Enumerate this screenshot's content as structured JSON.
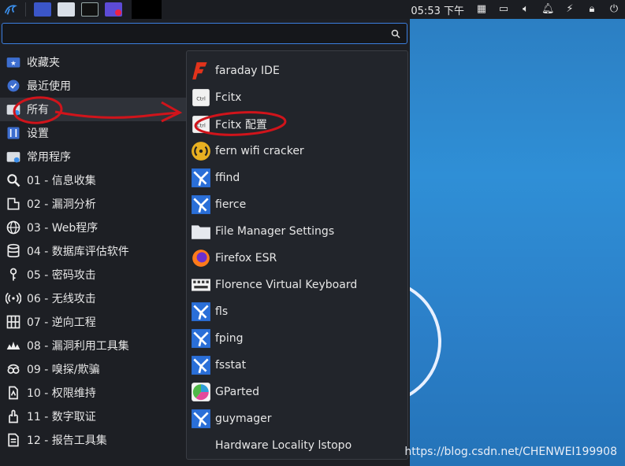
{
  "panel": {
    "clock": "05:53 下午",
    "launcher_icon": "kali-dragon-icon",
    "task_icons": [
      "files-icon",
      "file-manager-icon",
      "terminal-icon",
      "screen-recorder-icon"
    ],
    "tray_icons": [
      "keyboard-icon",
      "display-icon",
      "volume-icon",
      "notification-icon",
      "update-icon",
      "lock-icon",
      "logout-icon"
    ]
  },
  "search": {
    "placeholder": "",
    "value": ""
  },
  "categories": [
    {
      "label": "收藏夹",
      "icon": "star-folder-icon"
    },
    {
      "label": "最近使用",
      "icon": "recent-icon"
    },
    {
      "label": "所有",
      "icon": "all-folder-icon"
    },
    {
      "label": "设置",
      "icon": "settings-icon"
    },
    {
      "label": "常用程序",
      "icon": "common-apps-icon"
    },
    {
      "label": "01 - 信息收集",
      "icon": "magnifier-icon"
    },
    {
      "label": "02 - 漏洞分析",
      "icon": "vuln-analysis-icon"
    },
    {
      "label": "03 - Web程序",
      "icon": "web-icon"
    },
    {
      "label": "04 - 数据库评估软件",
      "icon": "database-icon"
    },
    {
      "label": "05 - 密码攻击",
      "icon": "key-icon"
    },
    {
      "label": "06 - 无线攻击",
      "icon": "wireless-icon"
    },
    {
      "label": "07 - 逆向工程",
      "icon": "reverse-eng-icon"
    },
    {
      "label": "08 - 漏洞利用工具集",
      "icon": "exploit-icon"
    },
    {
      "label": "09 - 嗅探/欺骗",
      "icon": "sniff-icon"
    },
    {
      "label": "10 - 权限维持",
      "icon": "persistence-icon"
    },
    {
      "label": "11 - 数字取证",
      "icon": "forensics-icon"
    },
    {
      "label": "12 - 报告工具集",
      "icon": "report-icon"
    }
  ],
  "apps": [
    {
      "label": "faraday IDE",
      "icon": "faraday-icon"
    },
    {
      "label": "Fcitx",
      "icon": "fcitx-icon"
    },
    {
      "label": "Fcitx 配置",
      "icon": "fcitx-config-icon"
    },
    {
      "label": "fern wifi cracker",
      "icon": "fern-wifi-icon"
    },
    {
      "label": "ffind",
      "icon": "kali-tool-icon"
    },
    {
      "label": "fierce",
      "icon": "kali-tool-icon"
    },
    {
      "label": "File Manager Settings",
      "icon": "folder-icon"
    },
    {
      "label": "Firefox ESR",
      "icon": "firefox-icon"
    },
    {
      "label": "Florence Virtual Keyboard",
      "icon": "keyboard-icon"
    },
    {
      "label": "fls",
      "icon": "kali-tool-icon"
    },
    {
      "label": "fping",
      "icon": "kali-tool-icon"
    },
    {
      "label": "fsstat",
      "icon": "kali-tool-icon"
    },
    {
      "label": "GParted",
      "icon": "gparted-icon"
    },
    {
      "label": "guymager",
      "icon": "kali-tool-icon"
    },
    {
      "label": "Hardware Locality lstopo",
      "icon": ""
    }
  ],
  "watermark": "https://blog.csdn.net/CHENWEI199908",
  "colors": {
    "panel": "#1b1d22",
    "menu_bg": "#1d1f24",
    "accent": "#3b7fe0",
    "annotation": "#d0141b",
    "desktop": "#2c86cf"
  }
}
